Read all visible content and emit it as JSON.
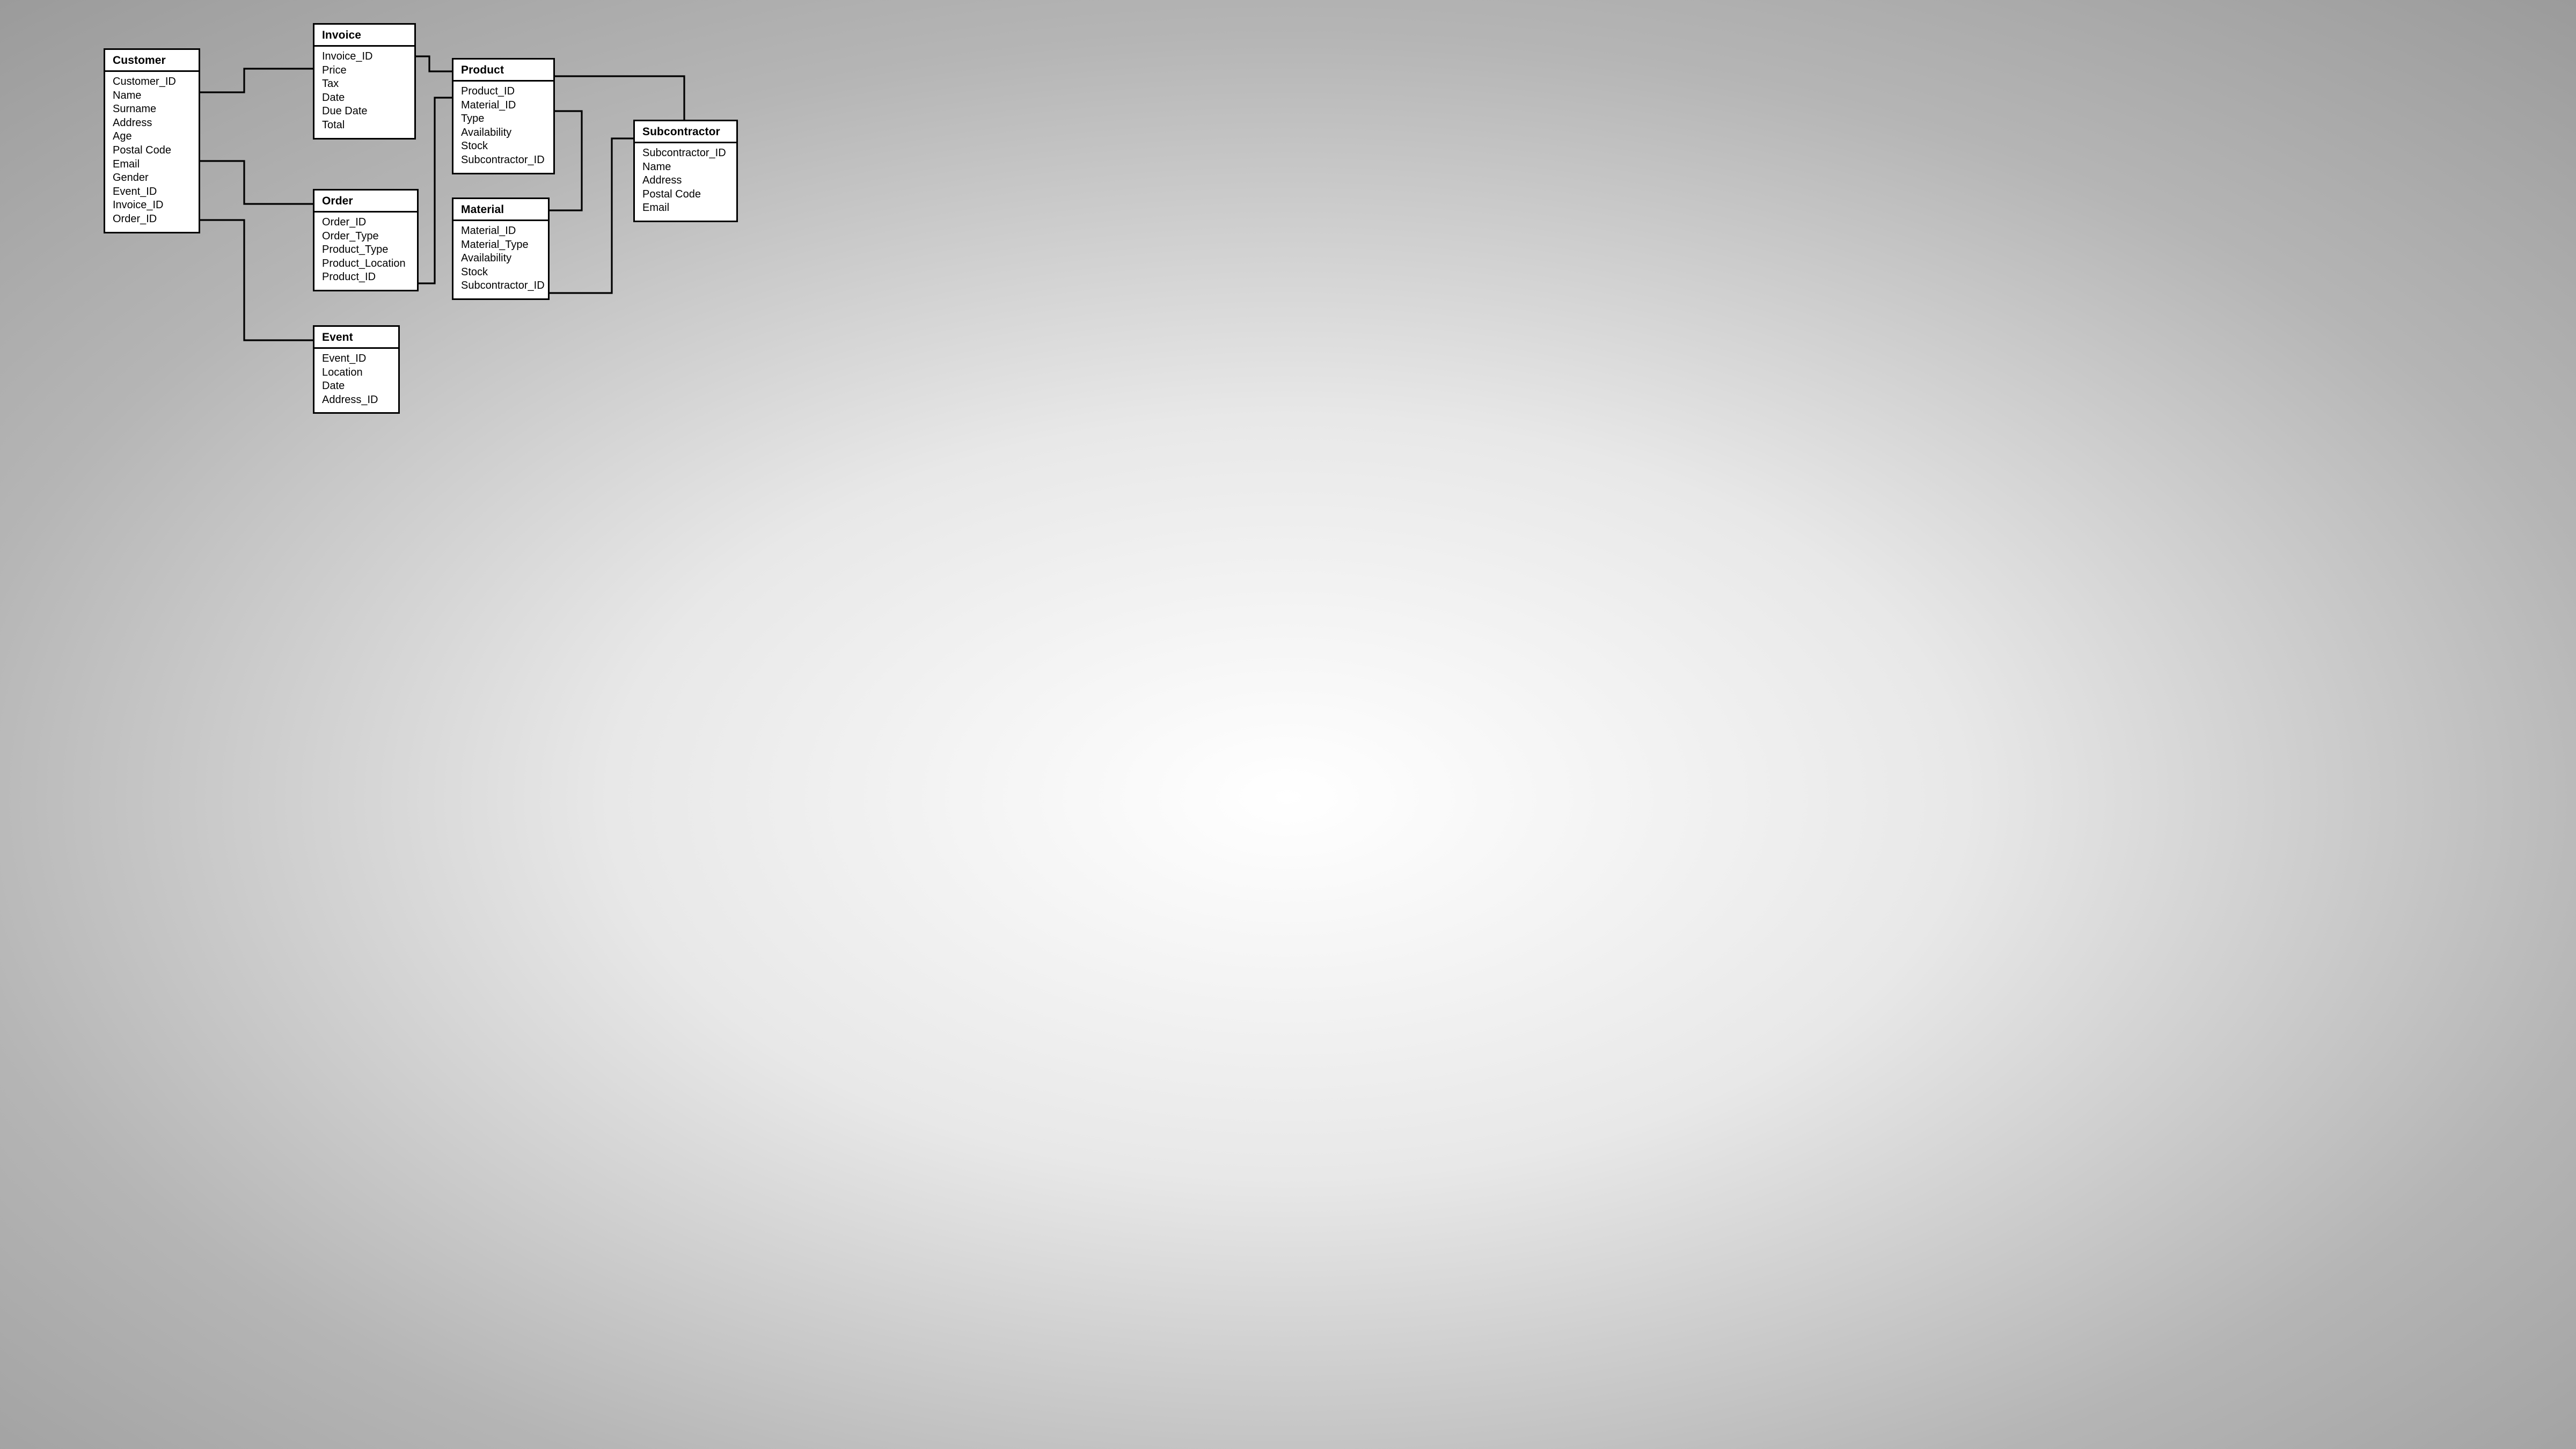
{
  "entities": {
    "customer": {
      "title": "Customer",
      "fields": [
        "Customer_ID",
        "Name",
        "Surname",
        "Address",
        "Age",
        "Postal Code",
        "Email",
        "Gender",
        "Event_ID",
        "Invoice_ID",
        "Order_ID"
      ]
    },
    "invoice": {
      "title": "Invoice",
      "fields": [
        "Invoice_ID",
        "Price",
        "Tax",
        "Date",
        "Due Date",
        "Total"
      ]
    },
    "order": {
      "title": "Order",
      "fields": [
        "Order_ID",
        "Order_Type",
        "Product_Type",
        "Product_Location",
        "Product_ID"
      ]
    },
    "event": {
      "title": "Event",
      "fields": [
        "Event_ID",
        "Location",
        "Date",
        "Address_ID"
      ]
    },
    "product": {
      "title": "Product",
      "fields": [
        "Product_ID",
        "Material_ID",
        "Type",
        "Availability",
        "Stock",
        "Subcontractor_ID"
      ]
    },
    "material": {
      "title": "Material",
      "fields": [
        "Material_ID",
        "Material_Type",
        "Availability",
        "Stock",
        "Subcontractor_ID"
      ]
    },
    "subcontractor": {
      "title": "Subcontractor",
      "fields": [
        "Subcontractor_ID",
        "Name",
        "Address",
        "Postal Code",
        "Email"
      ]
    }
  }
}
